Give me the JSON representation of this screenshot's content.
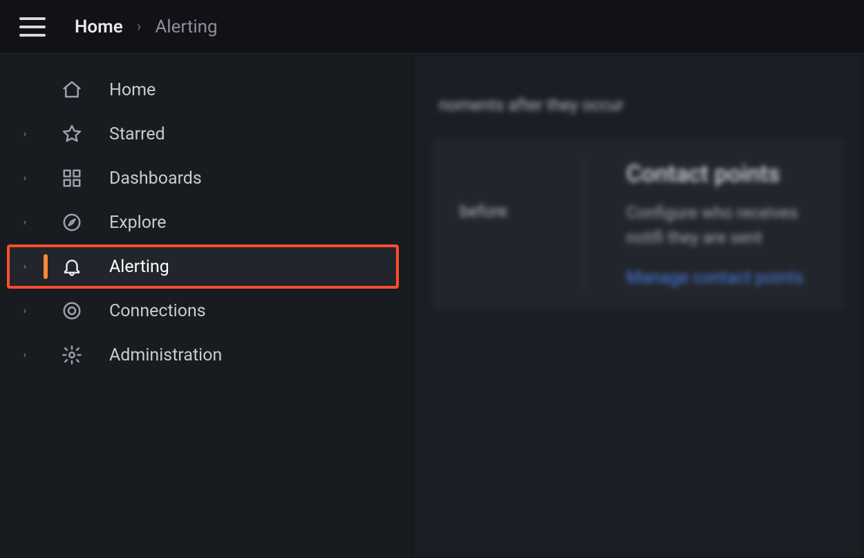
{
  "breadcrumb": {
    "home": "Home",
    "current": "Alerting"
  },
  "sidebar": {
    "items": [
      {
        "label": "Home",
        "icon": "home-icon",
        "expandable": false,
        "active": false
      },
      {
        "label": "Starred",
        "icon": "star-icon",
        "expandable": true,
        "active": false
      },
      {
        "label": "Dashboards",
        "icon": "dashboards-icon",
        "expandable": true,
        "active": false
      },
      {
        "label": "Explore",
        "icon": "compass-icon",
        "expandable": true,
        "active": false
      },
      {
        "label": "Alerting",
        "icon": "bell-icon",
        "expandable": true,
        "active": true
      },
      {
        "label": "Connections",
        "icon": "link-icon",
        "expandable": true,
        "active": false
      },
      {
        "label": "Administration",
        "icon": "gear-icon",
        "expandable": true,
        "active": false
      }
    ]
  },
  "content": {
    "top_text_fragment": "noments after they occur",
    "left_fragment": "before",
    "card": {
      "title": "Contact points",
      "description": "Configure who receives notifi they are sent",
      "link_label": "Manage contact points"
    }
  }
}
